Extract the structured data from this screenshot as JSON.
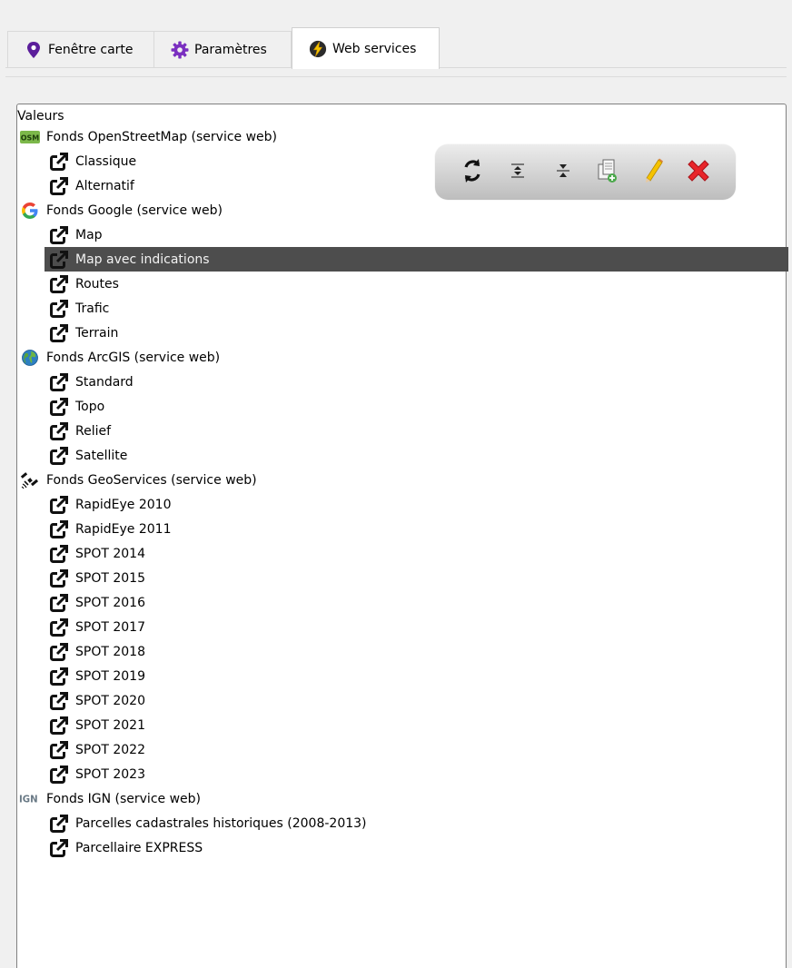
{
  "tabs": [
    {
      "label": "Fenêtre carte",
      "icon": "map-pin-icon",
      "active": false
    },
    {
      "label": "Paramètres",
      "icon": "gear-icon",
      "active": false
    },
    {
      "label": "Web services",
      "icon": "lightning-icon",
      "active": true
    }
  ],
  "tree": {
    "header": "Valeurs",
    "groups": [
      {
        "label": "Fonds OpenStreetMap (service web)",
        "icon": "osm-icon",
        "items": [
          "Classique",
          "Alternatif"
        ]
      },
      {
        "label": "Fonds Google (service web)",
        "icon": "google-icon",
        "items": [
          "Map",
          "Map avec indications",
          "Routes",
          "Trafic",
          "Terrain"
        ]
      },
      {
        "label": "Fonds ArcGIS (service web)",
        "icon": "globe-icon",
        "items": [
          "Standard",
          "Topo",
          "Relief",
          "Satellite"
        ]
      },
      {
        "label": "Fonds GeoServices (service web)",
        "icon": "satellite-icon",
        "items": [
          "RapidEye 2010",
          "RapidEye 2011",
          "SPOT 2014",
          "SPOT 2015",
          "SPOT 2016",
          "SPOT 2017",
          "SPOT 2018",
          "SPOT 2019",
          "SPOT 2020",
          "SPOT 2021",
          "SPOT 2022",
          "SPOT 2023"
        ]
      },
      {
        "label": "Fonds IGN (service web)",
        "icon": "ign-icon",
        "items": [
          "Parcelles cadastrales historiques (2008-2013)",
          "Parcellaire EXPRESS"
        ]
      }
    ],
    "selected_item": "Map avec indications",
    "ign_logo_text": "IGN",
    "osm_logo_text": "OSM"
  },
  "toolbar": {
    "buttons": [
      {
        "name": "refresh-button",
        "icon": "refresh-icon"
      },
      {
        "name": "expand-all-button",
        "icon": "expand-icon"
      },
      {
        "name": "collapse-all-button",
        "icon": "collapse-icon"
      },
      {
        "name": "add-copy-button",
        "icon": "add-copy-icon"
      },
      {
        "name": "edit-button",
        "icon": "pencil-icon"
      },
      {
        "name": "delete-button",
        "icon": "red-x-icon"
      }
    ]
  },
  "colors": {
    "selection_bg": "#4d4d4d",
    "pin": "#5b1e9b",
    "gear": "#7a2fc0",
    "delete": "#e8252a"
  }
}
